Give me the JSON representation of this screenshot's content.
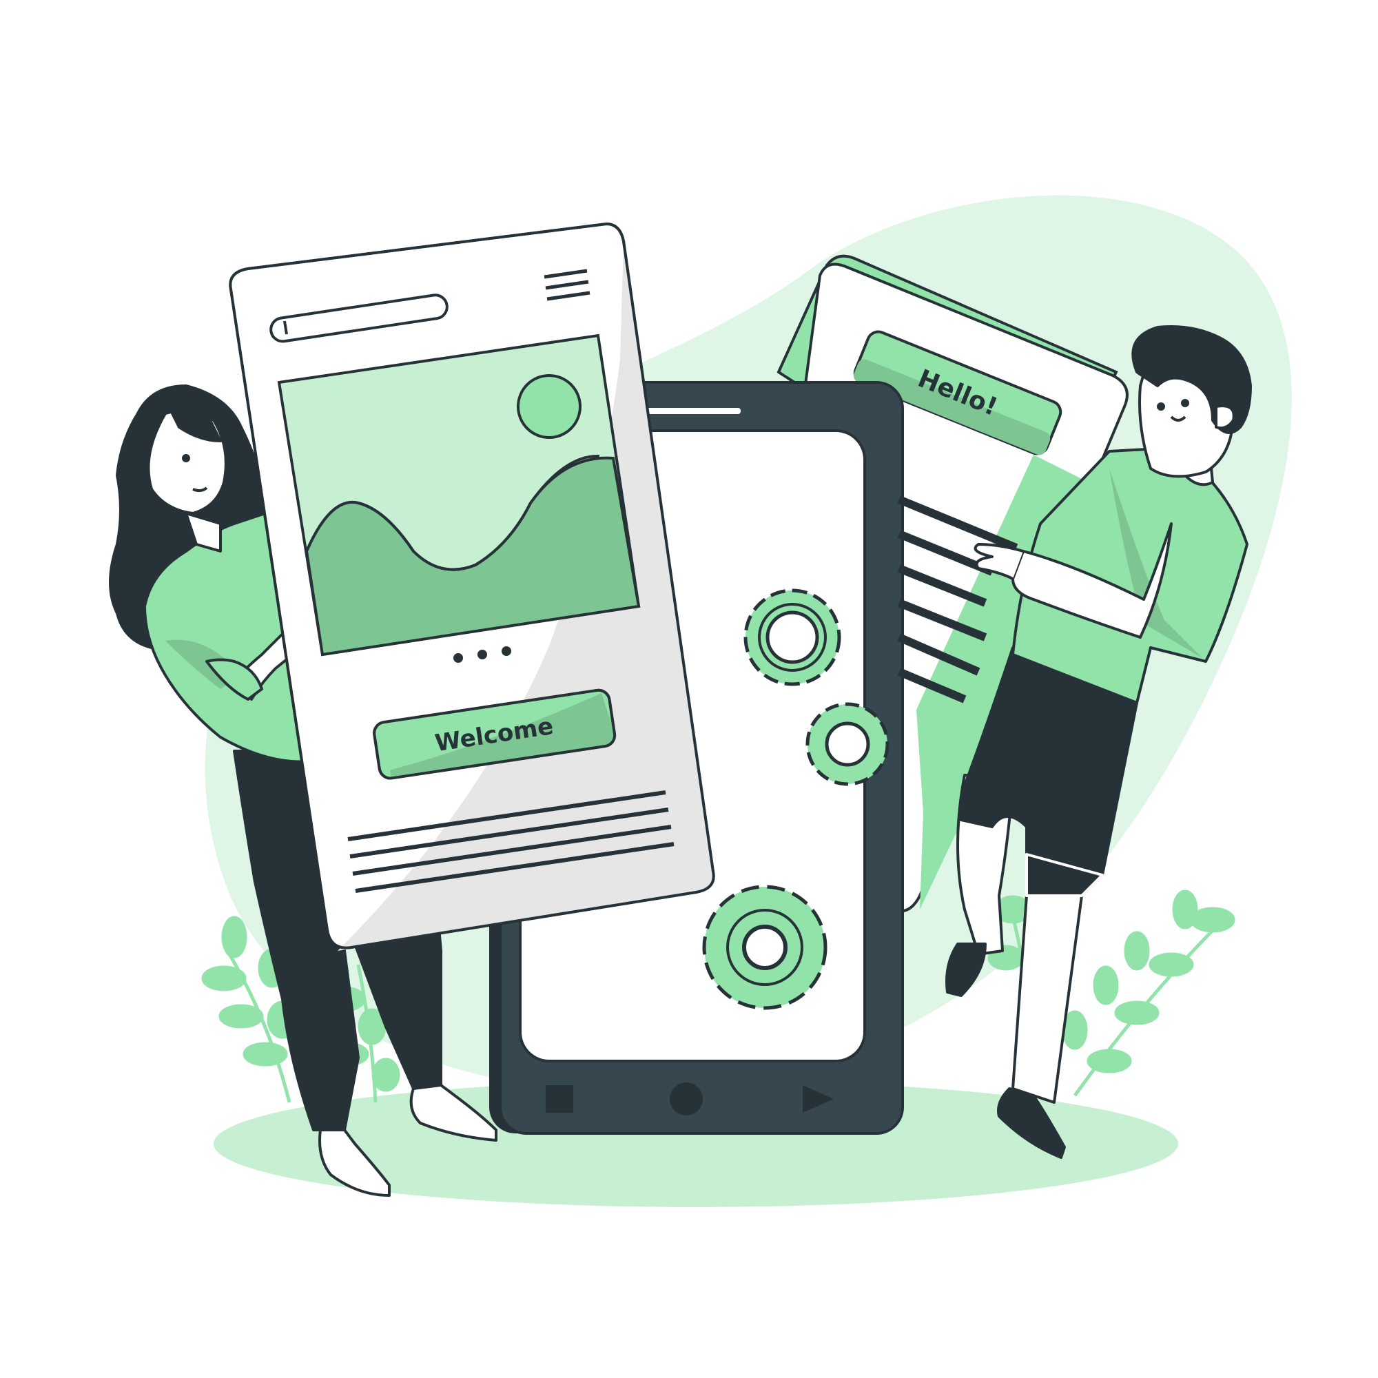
{
  "colors": {
    "accent": "#92E3A9",
    "accent_dark": "#7DC693",
    "accent_light": "#C7F0D2",
    "accent_pale": "#DFF6E6",
    "ink": "#263238",
    "phone_body": "#37474F",
    "paper": "#FFFFFF",
    "panel_gray": "#E6E6E6"
  },
  "left_card": {
    "button_label": "Welcome",
    "carousel_dots": 3
  },
  "right_card": {
    "button_label": "Hello!"
  },
  "phone": {
    "nav_icons": [
      "square-stop-icon",
      "circle-home-icon",
      "triangle-play-icon"
    ],
    "gear_icons": [
      "gear-icon",
      "gear-icon",
      "gear-icon"
    ]
  }
}
